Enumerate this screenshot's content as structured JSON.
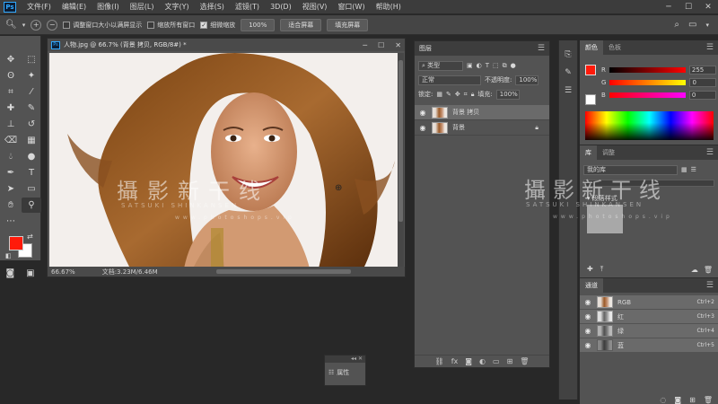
{
  "menubar": {
    "logo": "Ps",
    "items": [
      "文件(F)",
      "编辑(E)",
      "图像(I)",
      "图层(L)",
      "文字(Y)",
      "选择(S)",
      "滤镜(T)",
      "3D(D)",
      "视图(V)",
      "窗口(W)",
      "帮助(H)"
    ],
    "window_controls": {
      "minimize": "─",
      "maximize": "☐",
      "close": "✕"
    }
  },
  "options": {
    "resize_windows": "调整窗口大小以满屏显示",
    "zoom_all": "缩放所有窗口",
    "scrubby_zoom": "细微缩放",
    "zoom_value": "100%",
    "fit_screen": "适合屏幕",
    "fill_screen": "填充屏幕"
  },
  "document": {
    "tab_title": "人物.jpg @ 66.7% (背景 拷贝, RGB/8#) *",
    "zoom": "66.67%",
    "file_info": "文档:3.23M/6.46M",
    "watermark_main": "攝影新干线",
    "watermark_sub": "SATSUKI SHINKANSEN",
    "watermark_url": "www.photoshops.vip"
  },
  "layers": {
    "title": "图层",
    "filter": "类型",
    "blend_mode": "正常",
    "opacity_label": "不透明度:",
    "opacity": "100%",
    "lock_label": "锁定:",
    "fill_label": "填充:",
    "fill": "100%",
    "items": [
      {
        "name": "背景 拷贝",
        "active": true
      },
      {
        "name": "背景",
        "active": false
      }
    ]
  },
  "properties": {
    "label": "属性"
  },
  "color_panel": {
    "tabs": [
      "颜色",
      "色板"
    ],
    "r_label": "R",
    "r_value": "255",
    "g_label": "G",
    "g_value": "0",
    "b_label": "B",
    "b_value": "0",
    "colors": {
      "foreground": "#ff1a0a",
      "background": "#ffffff"
    }
  },
  "library": {
    "tabs": [
      "库",
      "调整"
    ],
    "selector": "我的库",
    "section": "段落样式"
  },
  "channels": {
    "title": "通道",
    "items": [
      {
        "name": "RGB",
        "shortcut": "Ctrl+2"
      },
      {
        "name": "红",
        "shortcut": "Ctrl+3"
      },
      {
        "name": "绿",
        "shortcut": "Ctrl+4"
      },
      {
        "name": "蓝",
        "shortcut": "Ctrl+5"
      }
    ]
  }
}
